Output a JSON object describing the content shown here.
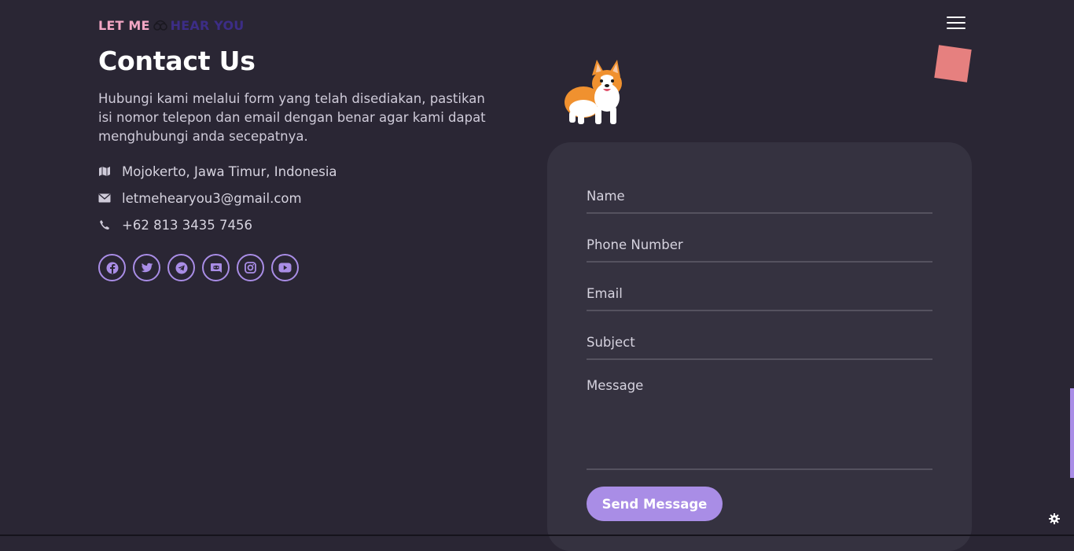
{
  "header": {
    "logo_left": "LET ME",
    "logo_right": "HEAR YOU",
    "menu_icon": "hamburger-menu-icon"
  },
  "contact": {
    "title": "Contact Us",
    "description": "Hubungi kami melalui form yang telah disediakan, pastikan isi nomor telepon dan email dengan benar agar kami dapat menghubungi anda secepatnya.",
    "address": "Mojokerto, Jawa Timur, Indonesia",
    "email": "letmehearyou3@gmail.com",
    "phone": "+62 813 3435 7456"
  },
  "socials": [
    "facebook-icon",
    "twitter-icon",
    "telegram-icon",
    "discord-icon",
    "instagram-icon",
    "youtube-icon"
  ],
  "form": {
    "name_label": "Name",
    "phone_label": "Phone Number",
    "email_label": "Email",
    "subject_label": "Subject",
    "message_label": "Message",
    "submit_label": "Send Message"
  },
  "colors": {
    "background": "#2a2634",
    "card": "#353240",
    "accent": "#a98de6",
    "logo_pink": "#f2a6c4",
    "logo_purple": "#3c2d86",
    "decor_square": "#e6807f"
  }
}
